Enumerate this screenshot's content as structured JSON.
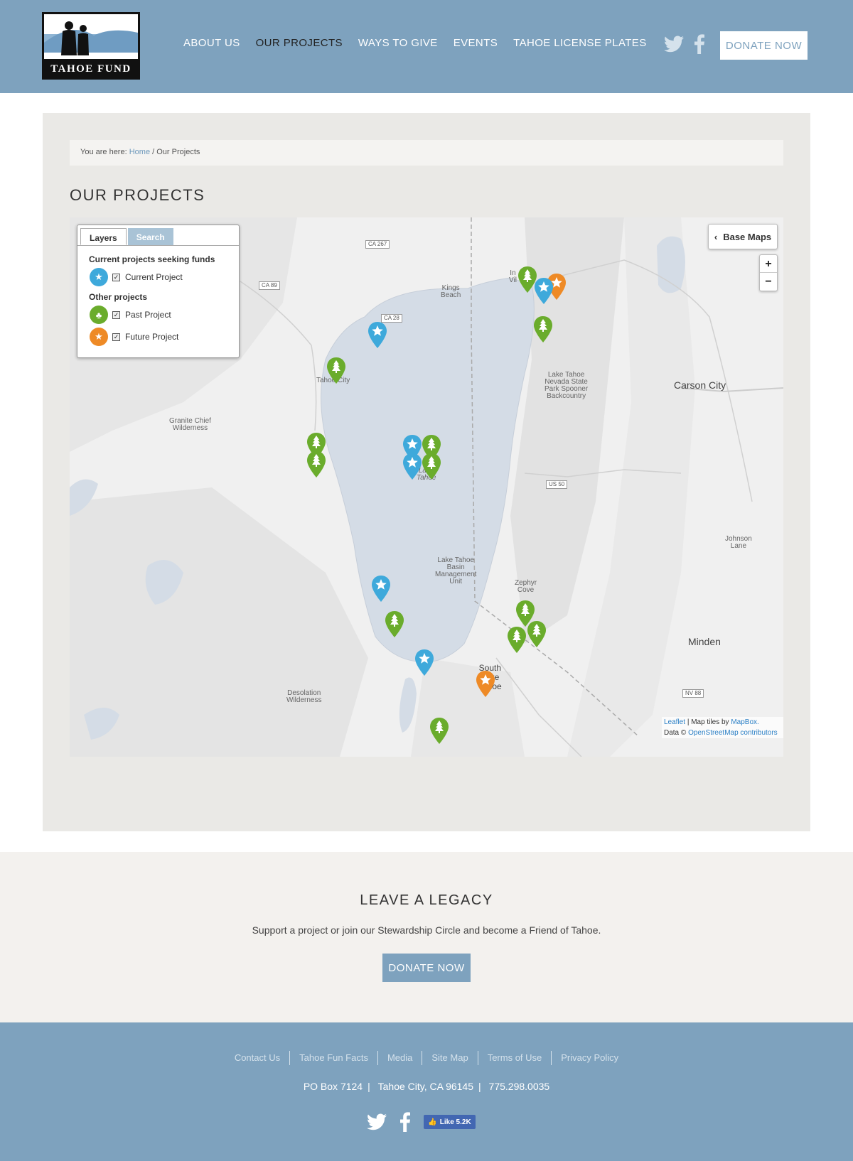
{
  "header": {
    "logo_text": "TAHOE FUND",
    "nav": [
      {
        "label": "ABOUT US"
      },
      {
        "label": "OUR PROJECTS"
      },
      {
        "label": "WAYS TO GIVE"
      },
      {
        "label": "EVENTS"
      },
      {
        "label": "TAHOE LICENSE PLATES"
      }
    ],
    "donate_label": "DONATE NOW",
    "social_icons": [
      "twitter-icon",
      "facebook-icon"
    ]
  },
  "breadcrumb": {
    "prefix": "You are here:",
    "home": "Home",
    "separator": "/",
    "current": "Our Projects"
  },
  "page_title": "OUR PROJECTS",
  "map": {
    "tabs": [
      "Layers",
      "Search"
    ],
    "legend": {
      "current_heading": "Current projects seeking funds",
      "current_project": "Current Project",
      "other_heading": "Other projects",
      "past_project": "Past Project",
      "future_project": "Future Project"
    },
    "base_maps_label": "Base Maps",
    "zoom_in": "+",
    "zoom_out": "−",
    "attribution": {
      "leaflet": "Leaflet",
      "tiles_text": "| Map tiles by",
      "mapbox": "MapBox.",
      "data_text": "Data ©",
      "osm": "OpenStreetMap contributors"
    },
    "labels": {
      "kings_beach_1": "Kings",
      "kings_beach_2": "Beach",
      "tahoe_city": "Tahoe City",
      "incline_1": "In",
      "incline_2": "Vil",
      "granite_1": "Granite Chief",
      "granite_2": "Wilderness",
      "spooner_1": "Lake Tahoe",
      "spooner_2": "Nevada State",
      "spooner_3": "Park Spooner",
      "spooner_4": "Backcountry",
      "carson_city": "Carson City",
      "lake_1": "Lake",
      "lake_2": "Tahoe",
      "basin_1": "Lake Tahoe",
      "basin_2": "Basin",
      "basin_3": "Management",
      "basin_4": "Unit",
      "zephyr_1": "Zephyr",
      "zephyr_2": "Cove",
      "johnson_1": "Johnson",
      "johnson_2": "Lane",
      "minden": "Minden",
      "south_1": "South",
      "south_2": "Lake",
      "south_3": "Tahoe",
      "desolation_1": "Desolation",
      "desolation_2": "Wilderness"
    },
    "roads": [
      "CA 267",
      "CA 89",
      "CA 28",
      "US 50",
      "NV 88"
    ],
    "colors": {
      "current": "#3ea9db",
      "past": "#6aac2c",
      "future": "#ee8a26",
      "lake": "#d4dce6"
    }
  },
  "legacy": {
    "title": "LEAVE A LEGACY",
    "text": "Support a project or join our Stewardship Circle and become a Friend of Tahoe.",
    "donate_label": "DONATE NOW"
  },
  "footer": {
    "links": [
      "Contact Us",
      "Tahoe Fun Facts",
      "Media",
      "Site Map",
      "Terms of Use",
      "Privacy Policy"
    ],
    "address": [
      "PO Box 7124",
      "Tahoe City, CA 96145",
      "775.298.0035"
    ],
    "fb_like": "Like 5.2K"
  }
}
